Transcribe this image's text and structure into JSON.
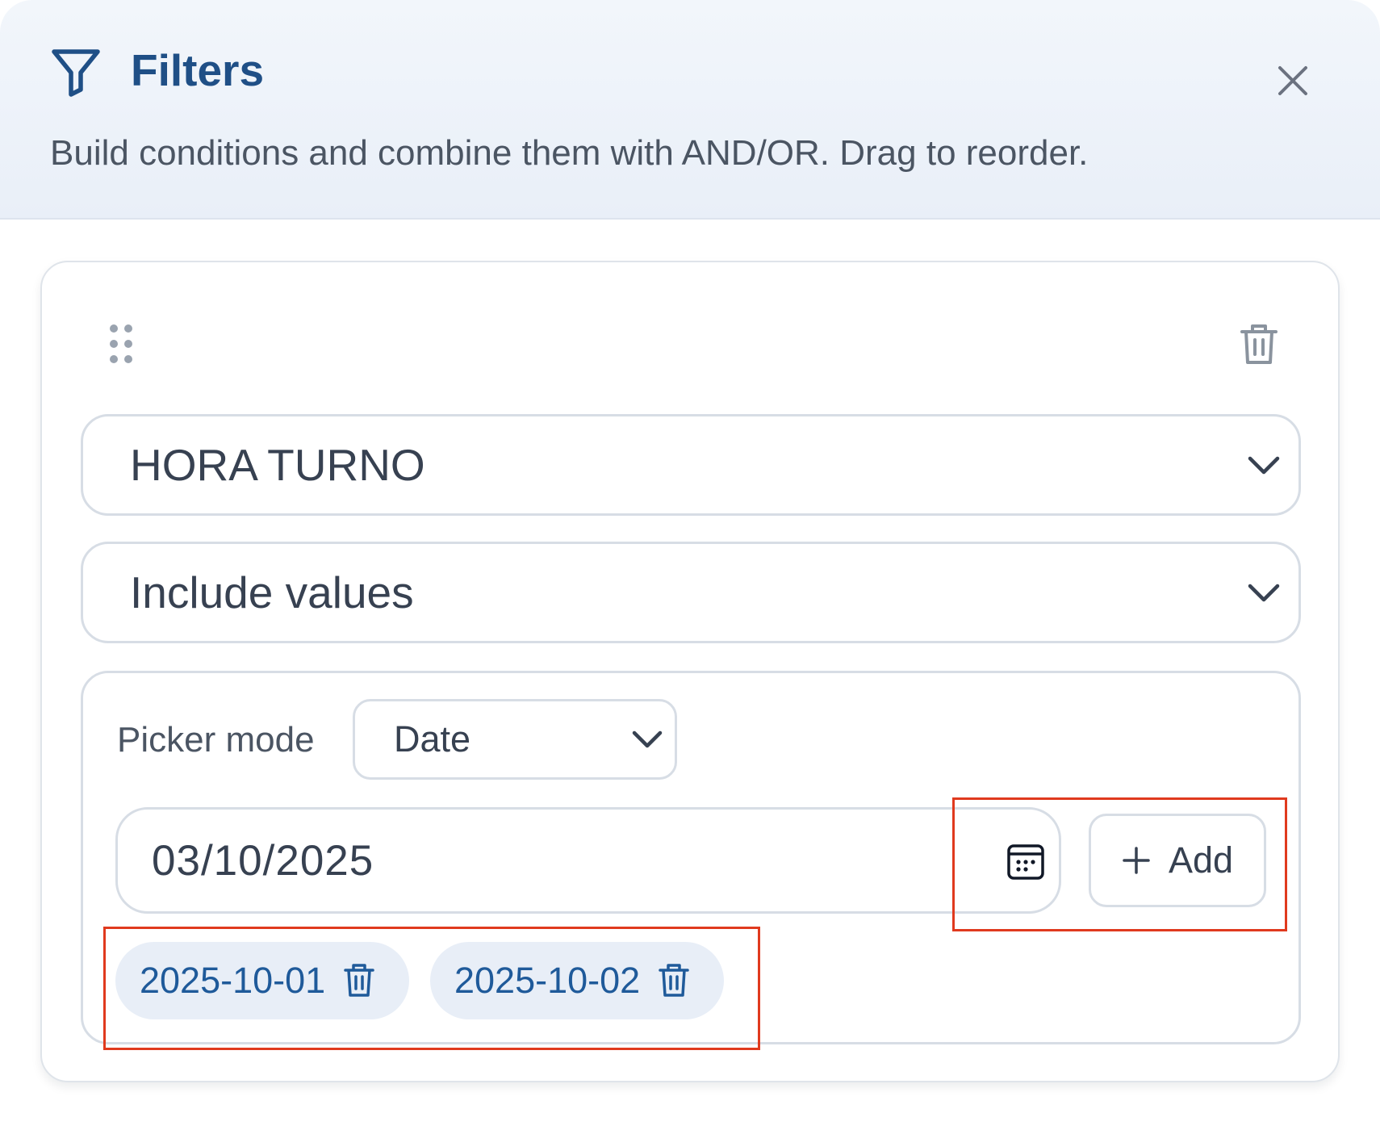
{
  "header": {
    "title": "Filters",
    "subtitle": "Build conditions and combine them with AND/OR. Drag to reorder.",
    "icons": {
      "filter": "funnel-icon",
      "close": "close-icon"
    }
  },
  "condition": {
    "field": {
      "value": "HORA TURNO"
    },
    "operator": {
      "value": "Include values"
    },
    "picker": {
      "label": "Picker mode",
      "mode_value": "Date"
    },
    "date_input": {
      "value": "03/10/2025"
    },
    "add_button": {
      "label": "Add"
    },
    "chips": [
      {
        "label": "2025-10-01"
      },
      {
        "label": "2025-10-02"
      }
    ]
  },
  "colors": {
    "accent": "#1f4f86",
    "chip_bg": "#e8eef7",
    "chip_text": "#1f5a9a",
    "highlight": "#e03a1e",
    "border": "#d7dde5"
  }
}
